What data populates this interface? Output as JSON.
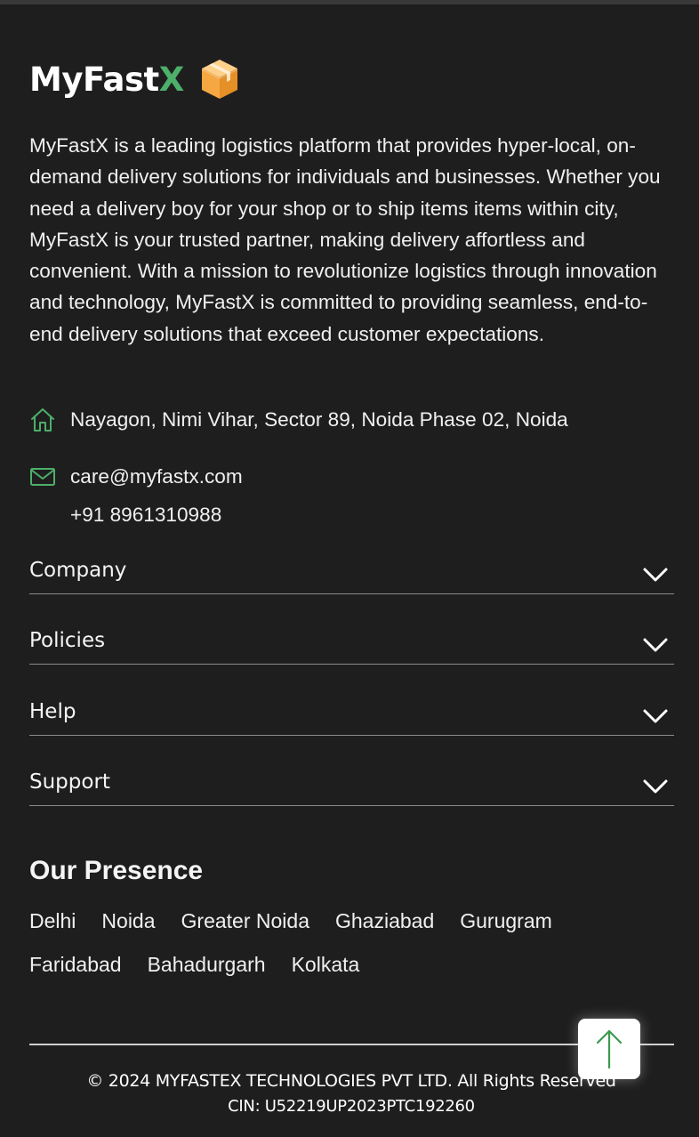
{
  "brand": {
    "name_main": "MyFast",
    "name_accent": "X",
    "icon": "package-box-icon",
    "accent_color": "#4caf6a",
    "box_color": "#f5a742"
  },
  "about": "MyFastX is a leading logistics platform that provides hyper-local, on-demand delivery solutions for individuals and businesses. Whether you need a delivery boy for your shop or to ship items items within city, MyFastX is your trusted partner, making delivery affortless and convenient. With a mission to revolutionize logistics through innovation and technology, MyFastX is committed to providing seamless, end-to-end delivery solutions that exceed customer expectations.",
  "contact": {
    "address_icon": "home-icon",
    "address": "Nayagon, Nimi Vihar, Sector 89, Noida Phase 02, Noida",
    "email_icon": "mail-icon",
    "email": "care@myfastx.com",
    "phone": "+91 8961310988"
  },
  "sections": [
    {
      "label": "Company",
      "icon": "chevron-down-icon"
    },
    {
      "label": "Policies",
      "icon": "chevron-down-icon"
    },
    {
      "label": "Help",
      "icon": "chevron-down-icon"
    },
    {
      "label": "Support",
      "icon": "chevron-down-icon"
    }
  ],
  "presence": {
    "title": "Our Presence",
    "cities": [
      "Delhi",
      "Noida",
      "Greater Noida",
      "Ghaziabad",
      "Gurugram",
      "Faridabad",
      "Bahadurgarh",
      "Kolkata"
    ]
  },
  "legal": {
    "copyright": "© 2024 MYFASTEX TECHNOLOGIES PVT LTD. All Rights Reserved",
    "cin": "CIN: U52219UP2023PTC192260"
  },
  "scroll_top": {
    "icon": "arrow-up-icon",
    "color": "#3a9a4e"
  }
}
